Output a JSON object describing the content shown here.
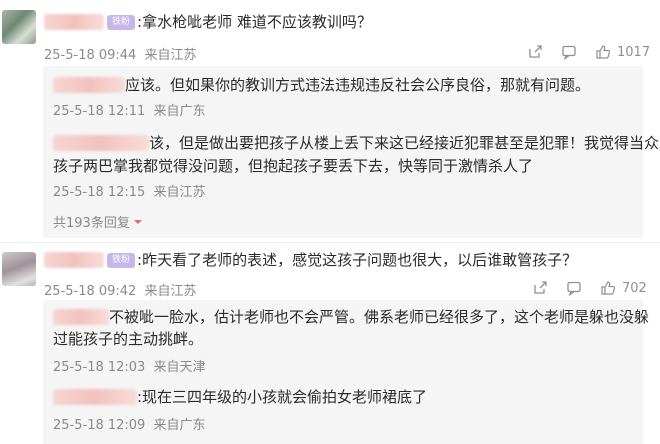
{
  "comments": [
    {
      "text": ":拿水枪呲老师 难道不应该教训吗？",
      "badge": "铁粉",
      "time": "25-5-18 09:44",
      "location": "来自江苏",
      "likes": "1017",
      "replies": [
        {
          "text": "应该。但如果你的教训方式违法违规违反社会公序良俗，那就有问题。",
          "time": "25-5-18 12:11",
          "location": "来自广东"
        },
        {
          "line1": "该，但是做出要把孩子从楼上丢下来这已经接近犯罪甚至是犯罪！我觉得当众扇",
          "line2": "孩子两巴掌我都觉得没问题，但抱起孩子要丢下去，快等同于激情杀人了",
          "time": "25-5-18 12:15",
          "location": "来自江苏"
        }
      ],
      "more_replies": "共193条回复"
    },
    {
      "text": ":昨天看了老师的表述，感觉这孩子问题也很大，以后谁敢管孩子？",
      "badge": "铁粉",
      "time": "25-5-18 09:42",
      "location": "来自江苏",
      "likes": "702",
      "replies": [
        {
          "line1": "不被呲一脸水，估计老师也不会严管。佛系老师已经很多了，这个老师是躲也没躲",
          "line2": "过能孩子的主动挑衅。",
          "time": "25-5-18 12:03",
          "location": "来自天津"
        },
        {
          "text": ":现在三四年级的小孩就会偷拍女老师裙底了",
          "time": "25-5-18 12:09",
          "location": "来自广东"
        }
      ]
    }
  ],
  "icons": {
    "share": "share-icon",
    "comment": "comment-icon",
    "like": "thumbs-up-icon",
    "more_arrow": "caret-down-icon"
  },
  "colors": {
    "badge": "#c7b7e8",
    "reply_bg": "#f5f5f5",
    "meta": "#8a8a8a"
  }
}
